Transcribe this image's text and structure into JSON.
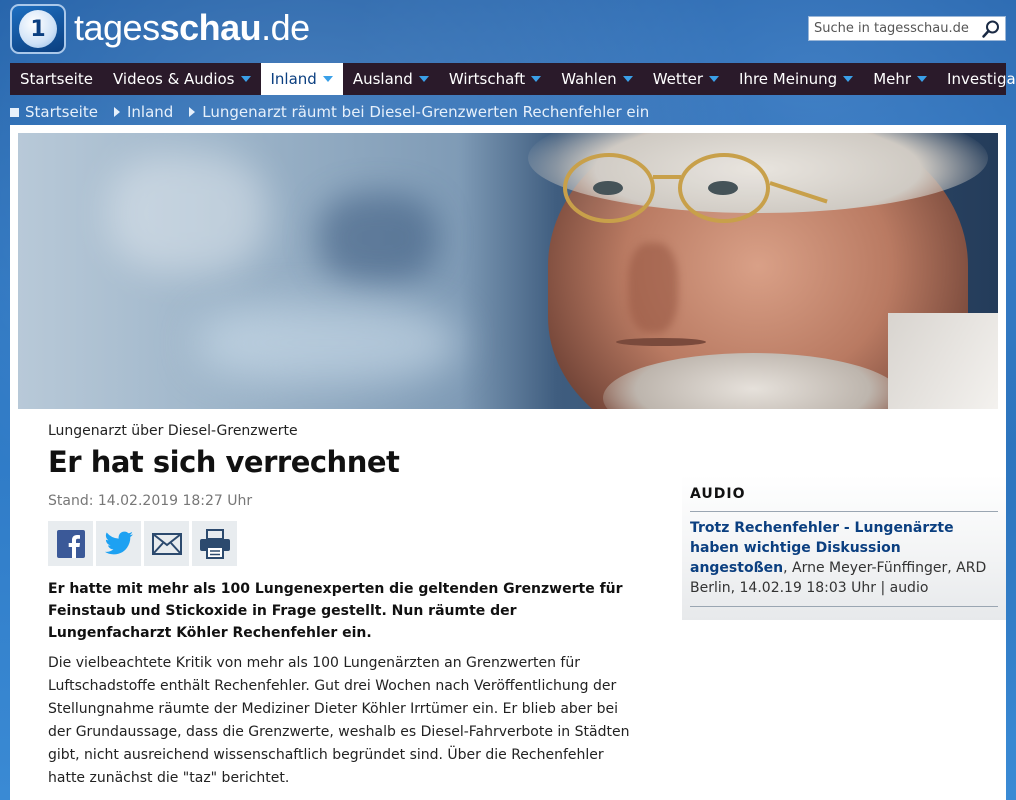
{
  "header": {
    "logo_text_light": "tages",
    "logo_text_bold": "schau",
    "logo_text_tld": ".de",
    "logo_emblem": "1",
    "search_placeholder": "Suche in tagesschau.de"
  },
  "nav": {
    "items": [
      {
        "label": "Startseite",
        "dropdown": false,
        "active": false
      },
      {
        "label": "Videos & Audios",
        "dropdown": true,
        "active": false
      },
      {
        "label": "Inland",
        "dropdown": true,
        "active": true
      },
      {
        "label": "Ausland",
        "dropdown": true,
        "active": false
      },
      {
        "label": "Wirtschaft",
        "dropdown": true,
        "active": false
      },
      {
        "label": "Wahlen",
        "dropdown": true,
        "active": false
      },
      {
        "label": "Wetter",
        "dropdown": true,
        "active": false
      },
      {
        "label": "Ihre Meinung",
        "dropdown": true,
        "active": false
      },
      {
        "label": "Mehr",
        "dropdown": true,
        "active": false
      },
      {
        "label": "Investigativ",
        "dropdown": false,
        "active": false
      }
    ]
  },
  "breadcrumb": {
    "items": [
      "Startseite",
      "Inland",
      "Lungenarzt räumt bei Diesel-Grenzwerten Rechenfehler ein"
    ]
  },
  "article": {
    "dachzeile": "Lungenarzt über Diesel-Grenzwerte",
    "headline": "Er hat sich verrechnet",
    "stand": "Stand: 14.02.2019 18:27 Uhr",
    "teaser": "Er hatte mit mehr als 100 Lungenexperten die geltenden Grenzwerte für Feinstaub und Stickoxide in Frage gestellt. Nun räumte der Lungenfacharzt Köhler Rechenfehler ein.",
    "body": "Die vielbeachtete Kritik von mehr als 100 Lungenärzten an Grenzwerten für Luftschadstoffe enthält Rechenfehler. Gut drei Wochen nach Veröffentlichung der Stellungnahme räumte der Mediziner Dieter Köhler Irrtümer ein. Er blieb aber bei der Grundaussage, dass die Grenzwerte, weshalb es Diesel-Fahrverbote in Städten gibt, nicht ausreichend wissenschaftlich begründet sind. Über die Rechenfehler hatte zunächst die \"taz\" berichtet."
  },
  "share": {
    "icons": [
      "facebook-icon",
      "twitter-icon",
      "mail-icon",
      "print-icon"
    ],
    "facebook_color": "#3b5998",
    "twitter_color": "#1da1f2",
    "mail_color": "#2c4a6e",
    "print_color": "#2c4a6e"
  },
  "aside": {
    "title": "AUDIO",
    "link_text": "Trotz Rechenfehler - Lungenärzte haben wichtige Diskussion angestoßen",
    "meta": ", Arne Meyer-Fünffinger, ARD Berlin, 14.02.19 18:03 Uhr | audio"
  },
  "colors": {
    "nav_background": "#2a1a2a",
    "accent_blue": "#0b3f80",
    "caret_blue": "#3aa0e8"
  }
}
